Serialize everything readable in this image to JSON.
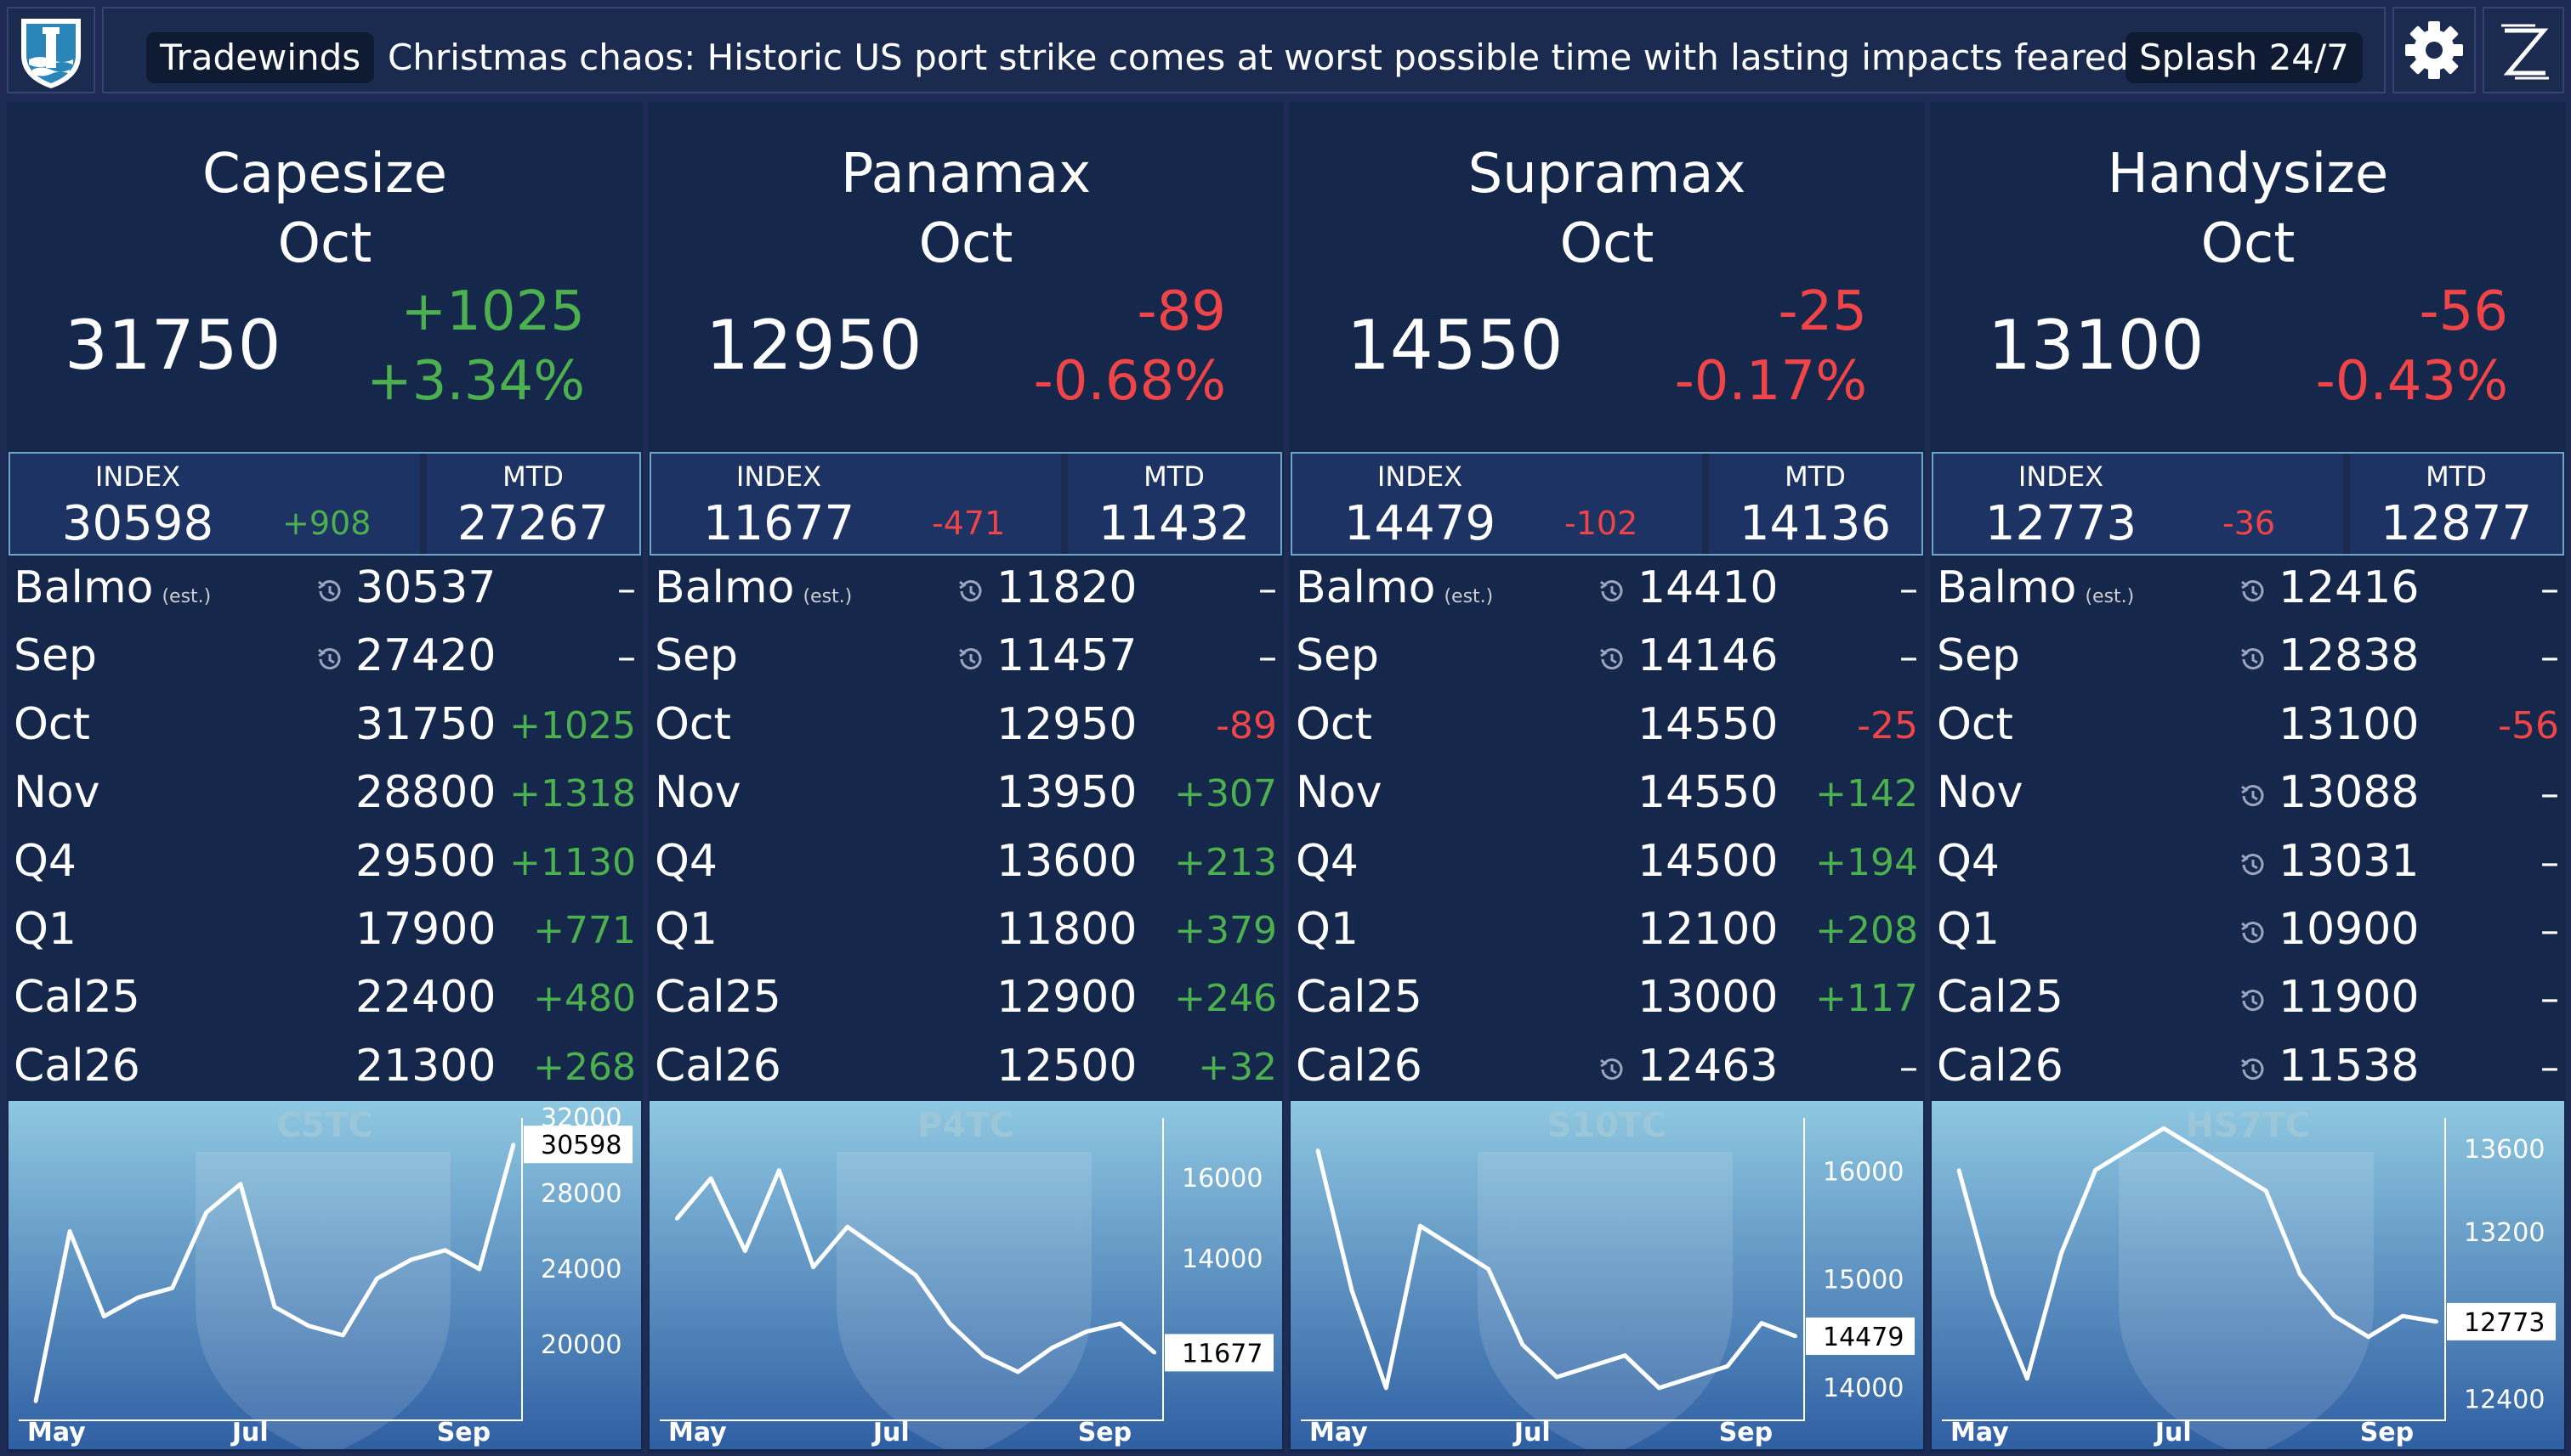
{
  "news": {
    "source": "Tradewinds",
    "headline": "Christmas chaos: Historic US port strike comes at worst possible time with lasting impacts feared",
    "service": "Splash 24/7"
  },
  "icons": {
    "logo": "lighthouse-logo-icon",
    "settings": "gear-icon",
    "brand": "z-logo-icon"
  },
  "colors": {
    "positive": "#4db04f",
    "negative": "#ef4548",
    "background": "#15274b",
    "chart_line": "#ffffff"
  },
  "panels": [
    {
      "name": "Capesize",
      "month": "Oct",
      "price": "31750",
      "change": "+1025",
      "change_pct": "+3.34%",
      "dir": "pos",
      "index": {
        "label": "INDEX",
        "value": "30598",
        "change": "+908",
        "dir": "pos"
      },
      "mtd": {
        "label": "MTD",
        "value": "27267"
      },
      "rows": [
        {
          "label": "Balmo",
          "note": "(est.)",
          "hist": true,
          "value": "30537",
          "change": "–",
          "dir": "neu"
        },
        {
          "label": "Sep",
          "hist": true,
          "value": "27420",
          "change": "–",
          "dir": "neu"
        },
        {
          "label": "Oct",
          "value": "31750",
          "change": "+1025",
          "dir": "pos"
        },
        {
          "label": "Nov",
          "value": "28800",
          "change": "+1318",
          "dir": "pos"
        },
        {
          "label": "Q4",
          "value": "29500",
          "change": "+1130",
          "dir": "pos"
        },
        {
          "label": "Q1",
          "value": "17900",
          "change": "+771",
          "dir": "pos"
        },
        {
          "label": "Cal25",
          "value": "22400",
          "change": "+480",
          "dir": "pos"
        },
        {
          "label": "Cal26",
          "value": "21300",
          "change": "+268",
          "dir": "pos"
        }
      ],
      "chart": {
        "title": "C5TC",
        "current": "30598",
        "yticks": [
          "32000",
          "28000",
          "24000",
          "20000"
        ],
        "xticks": [
          "May",
          "Jul",
          "Sep"
        ]
      }
    },
    {
      "name": "Panamax",
      "month": "Oct",
      "price": "12950",
      "change": "-89",
      "change_pct": "-0.68%",
      "dir": "neg",
      "index": {
        "label": "INDEX",
        "value": "11677",
        "change": "-471",
        "dir": "neg"
      },
      "mtd": {
        "label": "MTD",
        "value": "11432"
      },
      "rows": [
        {
          "label": "Balmo",
          "note": "(est.)",
          "hist": true,
          "value": "11820",
          "change": "–",
          "dir": "neu"
        },
        {
          "label": "Sep",
          "hist": true,
          "value": "11457",
          "change": "–",
          "dir": "neu"
        },
        {
          "label": "Oct",
          "value": "12950",
          "change": "-89",
          "dir": "neg"
        },
        {
          "label": "Nov",
          "value": "13950",
          "change": "+307",
          "dir": "pos"
        },
        {
          "label": "Q4",
          "value": "13600",
          "change": "+213",
          "dir": "pos"
        },
        {
          "label": "Q1",
          "value": "11800",
          "change": "+379",
          "dir": "pos"
        },
        {
          "label": "Cal25",
          "value": "12900",
          "change": "+246",
          "dir": "pos"
        },
        {
          "label": "Cal26",
          "value": "12500",
          "change": "+32",
          "dir": "pos"
        }
      ],
      "chart": {
        "title": "P4TC",
        "current": "11677",
        "yticks": [
          "16000",
          "14000"
        ],
        "xticks": [
          "May",
          "Jul",
          "Sep"
        ]
      }
    },
    {
      "name": "Supramax",
      "month": "Oct",
      "price": "14550",
      "change": "-25",
      "change_pct": "-0.17%",
      "dir": "neg",
      "index": {
        "label": "INDEX",
        "value": "14479",
        "change": "-102",
        "dir": "neg"
      },
      "mtd": {
        "label": "MTD",
        "value": "14136"
      },
      "rows": [
        {
          "label": "Balmo",
          "note": "(est.)",
          "hist": true,
          "value": "14410",
          "change": "–",
          "dir": "neu"
        },
        {
          "label": "Sep",
          "hist": true,
          "value": "14146",
          "change": "–",
          "dir": "neu"
        },
        {
          "label": "Oct",
          "value": "14550",
          "change": "-25",
          "dir": "neg"
        },
        {
          "label": "Nov",
          "value": "14550",
          "change": "+142",
          "dir": "pos"
        },
        {
          "label": "Q4",
          "value": "14500",
          "change": "+194",
          "dir": "pos"
        },
        {
          "label": "Q1",
          "value": "12100",
          "change": "+208",
          "dir": "pos"
        },
        {
          "label": "Cal25",
          "value": "13000",
          "change": "+117",
          "dir": "pos"
        },
        {
          "label": "Cal26",
          "hist": true,
          "value": "12463",
          "change": "–",
          "dir": "neu"
        }
      ],
      "chart": {
        "title": "S10TC",
        "current": "14479",
        "yticks": [
          "16000",
          "15000",
          "14000"
        ],
        "xticks": [
          "May",
          "Jul",
          "Sep"
        ]
      }
    },
    {
      "name": "Handysize",
      "month": "Oct",
      "price": "13100",
      "change": "-56",
      "change_pct": "-0.43%",
      "dir": "neg",
      "index": {
        "label": "INDEX",
        "value": "12773",
        "change": "-36",
        "dir": "neg"
      },
      "mtd": {
        "label": "MTD",
        "value": "12877"
      },
      "rows": [
        {
          "label": "Balmo",
          "note": "(est.)",
          "hist": true,
          "value": "12416",
          "change": "–",
          "dir": "neu"
        },
        {
          "label": "Sep",
          "hist": true,
          "value": "12838",
          "change": "–",
          "dir": "neu"
        },
        {
          "label": "Oct",
          "value": "13100",
          "change": "-56",
          "dir": "neg"
        },
        {
          "label": "Nov",
          "hist": true,
          "value": "13088",
          "change": "–",
          "dir": "neu"
        },
        {
          "label": "Q4",
          "hist": true,
          "value": "13031",
          "change": "–",
          "dir": "neu"
        },
        {
          "label": "Q1",
          "hist": true,
          "value": "10900",
          "change": "–",
          "dir": "neu"
        },
        {
          "label": "Cal25",
          "hist": true,
          "value": "11900",
          "change": "–",
          "dir": "neu"
        },
        {
          "label": "Cal26",
          "hist": true,
          "value": "11538",
          "change": "–",
          "dir": "neu"
        }
      ],
      "chart": {
        "title": "HS7TC",
        "current": "12773",
        "yticks": [
          "13600",
          "13200",
          "12400"
        ],
        "xticks": [
          "May",
          "Jul",
          "Sep"
        ]
      }
    }
  ],
  "chart_data": [
    {
      "type": "line",
      "title": "C5TC",
      "x": [
        "May",
        "",
        "",
        "",
        "",
        "",
        "Jul",
        "",
        "",
        "",
        "",
        "",
        "Sep",
        "",
        ""
      ],
      "values": [
        17000,
        26000,
        21500,
        22500,
        23000,
        27000,
        28500,
        22000,
        21000,
        20500,
        23500,
        24500,
        25000,
        24000,
        30598
      ],
      "ylim": [
        16000,
        32000
      ]
    },
    {
      "type": "line",
      "title": "P4TC",
      "x": [
        "May",
        "",
        "",
        "",
        "",
        "",
        "Jul",
        "",
        "",
        "",
        "",
        "",
        "Sep",
        "",
        ""
      ],
      "values": [
        15000,
        16000,
        14200,
        16200,
        13800,
        14800,
        14200,
        13600,
        12400,
        11600,
        11200,
        11800,
        12200,
        12400,
        11677
      ],
      "ylim": [
        10000,
        17500
      ]
    },
    {
      "type": "line",
      "title": "S10TC",
      "x": [
        "May",
        "",
        "",
        "",
        "",
        "",
        "Jul",
        "",
        "",
        "",
        "",
        "",
        "Sep",
        "",
        ""
      ],
      "values": [
        16200,
        14900,
        14000,
        15500,
        15300,
        15100,
        14400,
        14100,
        14200,
        14300,
        14000,
        14100,
        14200,
        14600,
        14479
      ],
      "ylim": [
        13700,
        16500
      ]
    },
    {
      "type": "line",
      "title": "HS7TC",
      "x": [
        "May",
        "",
        "",
        "",
        "",
        "",
        "Jul",
        "",
        "",
        "",
        "",
        "",
        "Sep",
        "",
        ""
      ],
      "values": [
        13500,
        12900,
        12500,
        13100,
        13500,
        13600,
        13700,
        13600,
        13500,
        13400,
        13000,
        12800,
        12700,
        12800,
        12773
      ],
      "ylim": [
        12300,
        13750
      ]
    }
  ]
}
